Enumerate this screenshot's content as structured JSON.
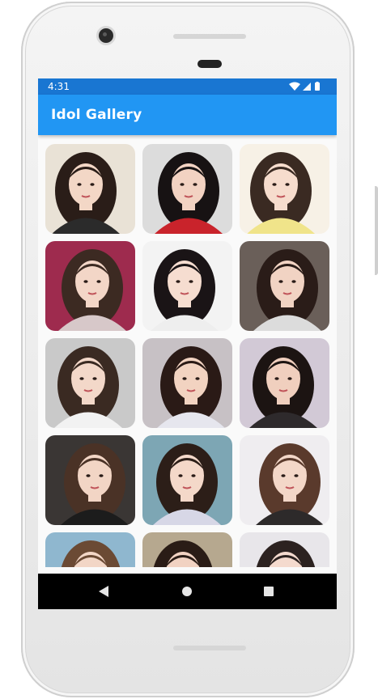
{
  "status_bar": {
    "time": "4:31"
  },
  "app_bar": {
    "title": "Idol Gallery"
  },
  "gallery": {
    "photos": [
      {
        "bg": "#e9e2d6",
        "hair": "#2a1d18",
        "skin": "#f3d7c6",
        "top": "#2b2b2b"
      },
      {
        "bg": "#dcdcdc",
        "hair": "#171213",
        "skin": "#f2d2c2",
        "top": "#c9232b"
      },
      {
        "bg": "#f7f1e6",
        "hair": "#3a2a22",
        "skin": "#f6dccd",
        "top": "#f0e48a"
      },
      {
        "bg": "#9e2b4e",
        "hair": "#3c2a22",
        "skin": "#f3d6c7",
        "top": "#d7c8c9"
      },
      {
        "bg": "#f3f3f3",
        "hair": "#1a1416",
        "skin": "#f6ddd0",
        "top": "#eeeeee"
      },
      {
        "bg": "#6a5f59",
        "hair": "#2a1c18",
        "skin": "#f1d3c3",
        "top": "#dcdcdc"
      },
      {
        "bg": "#c9c9c9",
        "hair": "#3a2a22",
        "skin": "#f3d8c9",
        "top": "#f2f2f2"
      },
      {
        "bg": "#c7c1c5",
        "hair": "#2a1a16",
        "skin": "#f2d3c1",
        "top": "#e6e6ee"
      },
      {
        "bg": "#d2c9d6",
        "hair": "#1c1412",
        "skin": "#f0cfbe",
        "top": "#2e2a2c"
      },
      {
        "bg": "#3a3634",
        "hair": "#4a3226",
        "skin": "#f2d5c5",
        "top": "#1c1c1c"
      },
      {
        "bg": "#7da6b4",
        "hair": "#2c1e18",
        "skin": "#f4d8c9",
        "top": "#d7d7e6"
      },
      {
        "bg": "#efedf0",
        "hair": "#5a3a2c",
        "skin": "#f3d7c8",
        "top": "#2d2a2a"
      },
      {
        "bg": "#8fb7cf",
        "hair": "#6b4a34",
        "skin": "#f2d6c6",
        "top": "#ffffff"
      },
      {
        "bg": "#b6a88f",
        "hair": "#2a1c16",
        "skin": "#f1d2c2",
        "top": "#6e5e4e"
      },
      {
        "bg": "#e8e6ea",
        "hair": "#2c2220",
        "skin": "#f4dace",
        "top": "#ffffff"
      }
    ]
  },
  "nav": {
    "back_icon": "back-triangle-icon",
    "home_icon": "home-circle-icon",
    "recents_icon": "recents-square-icon"
  }
}
